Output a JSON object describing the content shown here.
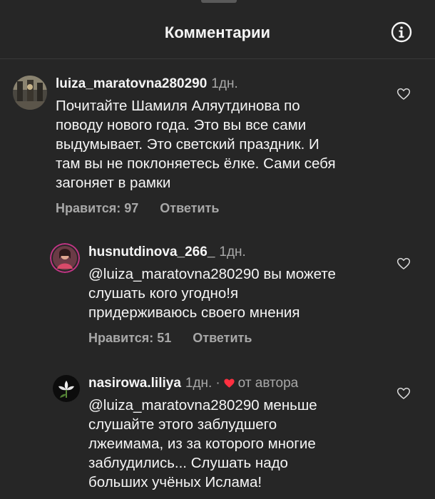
{
  "header": {
    "title": "Комментарии"
  },
  "comments": [
    {
      "username": "luiza_maratovna280290",
      "time": "1дн.",
      "text": "Почитайте Шамиля Аляутдинова по\nповоду нового года. Это вы все сами\nвыдумывает. Это светский праздник. И\nтам вы не поклоняетесь ёлке. Сами себя\nзагоняет в рамки",
      "likes_label": "Нравится: 97",
      "reply_label": "Ответить"
    },
    {
      "username": "husnutdinova_266_",
      "time": "1дн.",
      "text": "@luiza_maratovna280290 вы можете\nслушать кого угодно!я\nпридерживаюсь своего мнения",
      "likes_label": "Нравится: 51",
      "reply_label": "Ответить"
    },
    {
      "username": "nasirowa.liliya",
      "time": "1дн.",
      "dot": "·",
      "author_tag": "от автора",
      "text": "@luiza_maratovna280290 меньше\nслушайте этого заблудшего\nлжеимама,  из за которого многие\nзаблудились... Слушать надо\nбольших учёных Ислама!"
    }
  ]
}
